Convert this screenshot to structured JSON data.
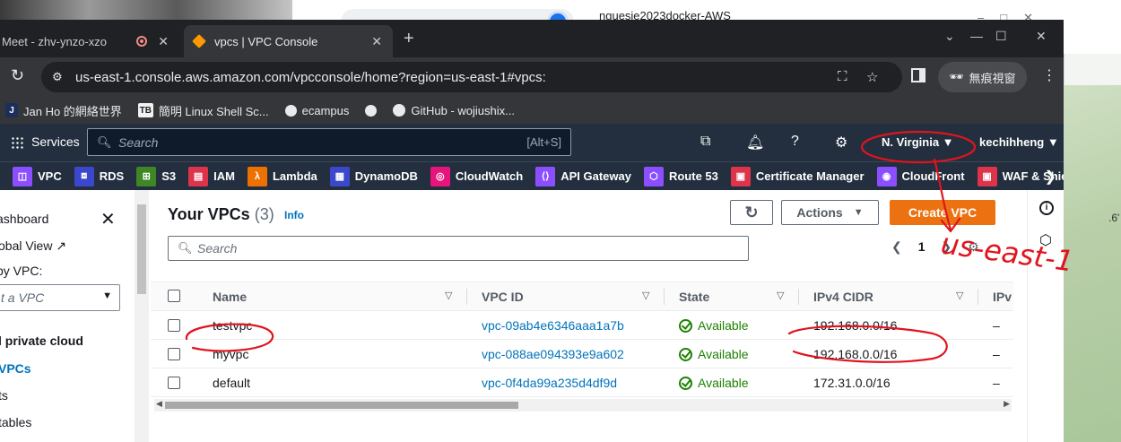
{
  "desktop": {
    "bg_window_title": "nguesie2023docker-AWS",
    "side_text": ".6'"
  },
  "browser": {
    "tabs": [
      {
        "label": "Meet - zhv-ynzo-xzo",
        "active": false
      },
      {
        "label": "vpcs | VPC Console",
        "active": true
      }
    ],
    "url": "us-east-1.console.aws.amazon.com/vpcconsole/home?region=us-east-1#vpcs:",
    "incognito_label": "無痕視窗",
    "bookmarks": [
      {
        "label": "Jan Ho 的網絡世界",
        "icon": "J"
      },
      {
        "label": "簡明 Linux Shell Sc...",
        "icon": "TB"
      },
      {
        "label": "ecampus",
        "icon": "globe-icon"
      },
      {
        "label": "",
        "icon": "globe-icon"
      },
      {
        "label": "GitHub - wojiushix...",
        "icon": "github-icon"
      }
    ]
  },
  "aws": {
    "services_label": "Services",
    "search_placeholder": "Search",
    "search_shortcut": "[Alt+S]",
    "region": "N. Virginia",
    "user": "kechihheng",
    "service_shortcuts": [
      {
        "label": "VPC",
        "color": "#8c4fff"
      },
      {
        "label": "RDS",
        "color": "#3b48cc"
      },
      {
        "label": "S3",
        "color": "#3f8624"
      },
      {
        "label": "IAM",
        "color": "#dd344c"
      },
      {
        "label": "Lambda",
        "color": "#ed7100"
      },
      {
        "label": "DynamoDB",
        "color": "#3b48cc"
      },
      {
        "label": "CloudWatch",
        "color": "#e7157b"
      },
      {
        "label": "API Gateway",
        "color": "#8c4fff"
      },
      {
        "label": "Route 53",
        "color": "#8c4fff"
      },
      {
        "label": "Certificate Manager",
        "color": "#dd344c"
      },
      {
        "label": "CloudFront",
        "color": "#8c4fff"
      },
      {
        "label": "WAF & Shie",
        "color": "#dd344c"
      }
    ]
  },
  "sidebar": {
    "items": [
      "ashboard",
      "obal View",
      "by VPC:",
      "l private cloud",
      "VPCs",
      "ts",
      "tables"
    ],
    "select_placeholder": "t a VPC"
  },
  "panel": {
    "title": "Your VPCs",
    "count": "(3)",
    "info": "Info",
    "actions_label": "Actions",
    "create_label": "Create VPC",
    "filter_placeholder": "Search",
    "page": "1",
    "columns": [
      "Name",
      "VPC ID",
      "State",
      "IPv4 CIDR",
      "IPv"
    ],
    "rows": [
      {
        "name": "testvpc",
        "vpc_id": "vpc-09ab4e6346aaa1a7b",
        "state": "Available",
        "cidr": "192.168.0.0/16",
        "extra": "–"
      },
      {
        "name": "myvpc",
        "vpc_id": "vpc-088ae094393e9a602",
        "state": "Available",
        "cidr": "192.168.0.0/16",
        "extra": "–"
      },
      {
        "name": "default",
        "vpc_id": "vpc-0f4da99a235d4df9d",
        "state": "Available",
        "cidr": "172.31.0.0/16",
        "extra": "–"
      }
    ]
  },
  "annotation": {
    "handwritten_text": "us-east-1",
    "color": "#e0141e"
  }
}
